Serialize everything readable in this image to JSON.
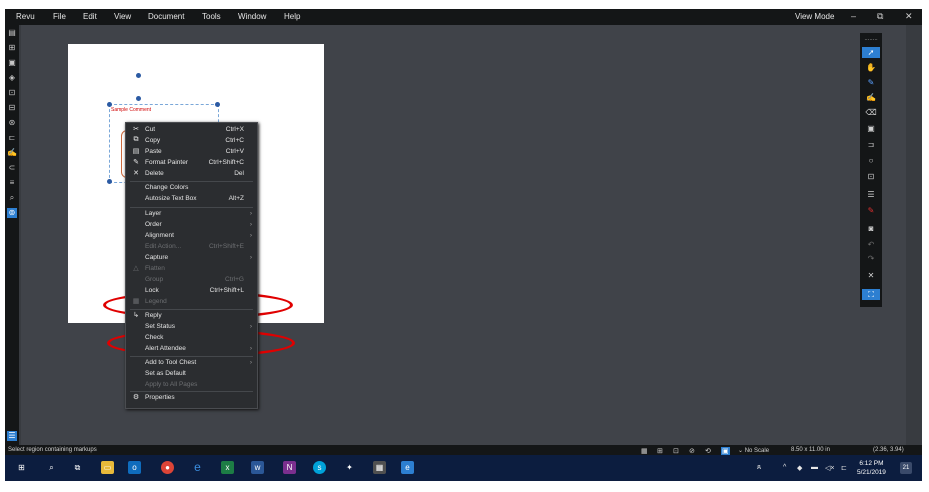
{
  "menubar": {
    "items": [
      "Revu",
      "File",
      "Edit",
      "View",
      "Document",
      "Tools",
      "Window",
      "Help"
    ],
    "view_mode": "View Mode",
    "window_buttons": [
      "–",
      "⧉",
      "✕"
    ]
  },
  "markup": {
    "comment_text": "Sample Comment"
  },
  "context_menu": {
    "items": [
      {
        "label": "Cut",
        "shortcut": "Ctrl+X",
        "icon": "scissors-icon"
      },
      {
        "label": "Copy",
        "shortcut": "Ctrl+C",
        "icon": "copy-icon"
      },
      {
        "label": "Paste",
        "shortcut": "Ctrl+V",
        "icon": "paste-icon"
      },
      {
        "label": "Format Painter",
        "shortcut": "Ctrl+Shift+C",
        "icon": "format-painter-icon"
      },
      {
        "label": "Delete",
        "shortcut": "Del",
        "icon": "delete-x-icon"
      },
      {
        "label": "Change Colors",
        "shortcut": ""
      },
      {
        "label": "Autosize Text Box",
        "shortcut": "Alt+Z"
      },
      {
        "label": "Layer",
        "submenu": true
      },
      {
        "label": "Order",
        "submenu": true
      },
      {
        "label": "Alignment",
        "submenu": true
      },
      {
        "label": "Edit Action...",
        "shortcut": "Ctrl+Shift+E",
        "disabled": true
      },
      {
        "label": "Capture",
        "submenu": true
      },
      {
        "label": "Flatten",
        "disabled": true
      },
      {
        "label": "Group",
        "shortcut": "Ctrl+G",
        "disabled": true
      },
      {
        "label": "Lock",
        "shortcut": "Ctrl+Shift+L"
      },
      {
        "label": "Legend",
        "disabled": true
      },
      {
        "label": "Reply"
      },
      {
        "label": "Set Status",
        "submenu": true
      },
      {
        "label": "Check"
      },
      {
        "label": "Alert Attendee",
        "submenu": true
      },
      {
        "label": "Add to Tool Chest",
        "submenu": true
      },
      {
        "label": "Set as Default"
      },
      {
        "label": "Apply to All Pages",
        "disabled": true
      },
      {
        "label": "Properties",
        "icon": "gear-icon"
      }
    ]
  },
  "statusbar": {
    "message": "Select region containing markups",
    "scale": "No Scale",
    "page_size": "8.50 x 11.00 in",
    "coordinates": "(2.36, 3.94)"
  },
  "taskbar": {
    "time": "6:12 PM",
    "date": "5/21/2019",
    "notification_count": "21"
  },
  "colors": {
    "accent": "#2d7fd1",
    "highlight_ellipse": "#e00000",
    "menubar_bg": "#141617",
    "canvas_bg": "#404349"
  }
}
